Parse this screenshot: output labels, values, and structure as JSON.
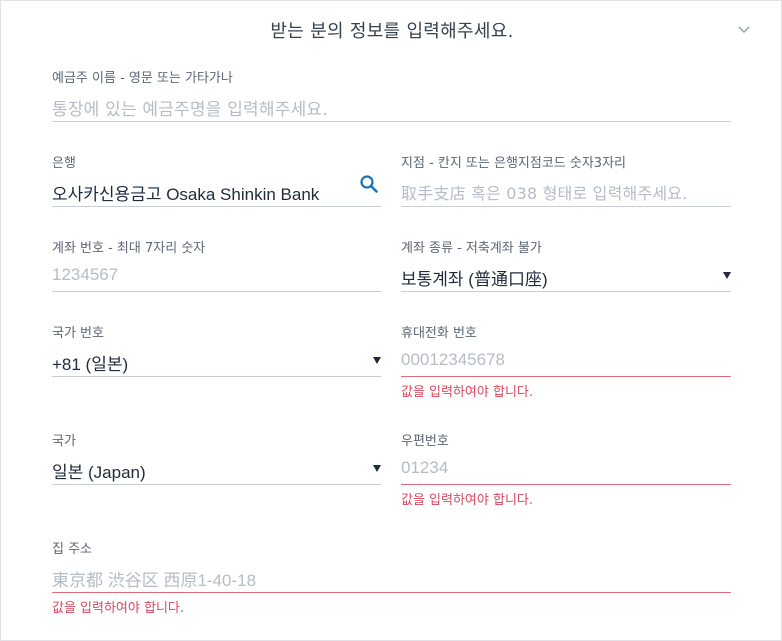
{
  "header": {
    "title": "받는 분의 정보를 입력해주세요."
  },
  "fields": {
    "name": {
      "label": "예금주 이름 - 영문 또는 가타가나",
      "placeholder": "통장에 있는 예금주명을 입력해주세요."
    },
    "bank": {
      "label": "은행",
      "value": "오사카신용금고 Osaka Shinkin Bank"
    },
    "branch": {
      "label": "지점 - 칸지 또는 은행지점코드 숫자3자리",
      "placeholder": "取手支店 혹은 038 형태로 입력해주세요."
    },
    "account_number": {
      "label": "계좌 번호 - 최대 7자리 숫자",
      "placeholder": "1234567"
    },
    "account_type": {
      "label": "계좌 종류 - 저축계좌 불가",
      "value": "보통계좌 (普通口座)"
    },
    "country_code": {
      "label": "국가 번호",
      "value": "+81 (일본)"
    },
    "mobile": {
      "label": "휴대전화 번호",
      "placeholder": "00012345678",
      "error": "값을 입력하여야 합니다."
    },
    "country": {
      "label": "국가",
      "value": "일본 (Japan)"
    },
    "postal": {
      "label": "우편번호",
      "placeholder": "01234",
      "error": "값을 입력하여야 합니다."
    },
    "address": {
      "label": "집 주소",
      "placeholder": "東京都 渋谷区 西原1-40-18",
      "error": "값을 입력하여야 합니다."
    }
  },
  "colors": {
    "accent": "#1a73b8",
    "error": "#d9475e",
    "underline": "#c9ced6"
  },
  "icons": {
    "collapse": "chevron-down-icon",
    "search": "search-icon",
    "dropdown": "caret-down-icon"
  }
}
